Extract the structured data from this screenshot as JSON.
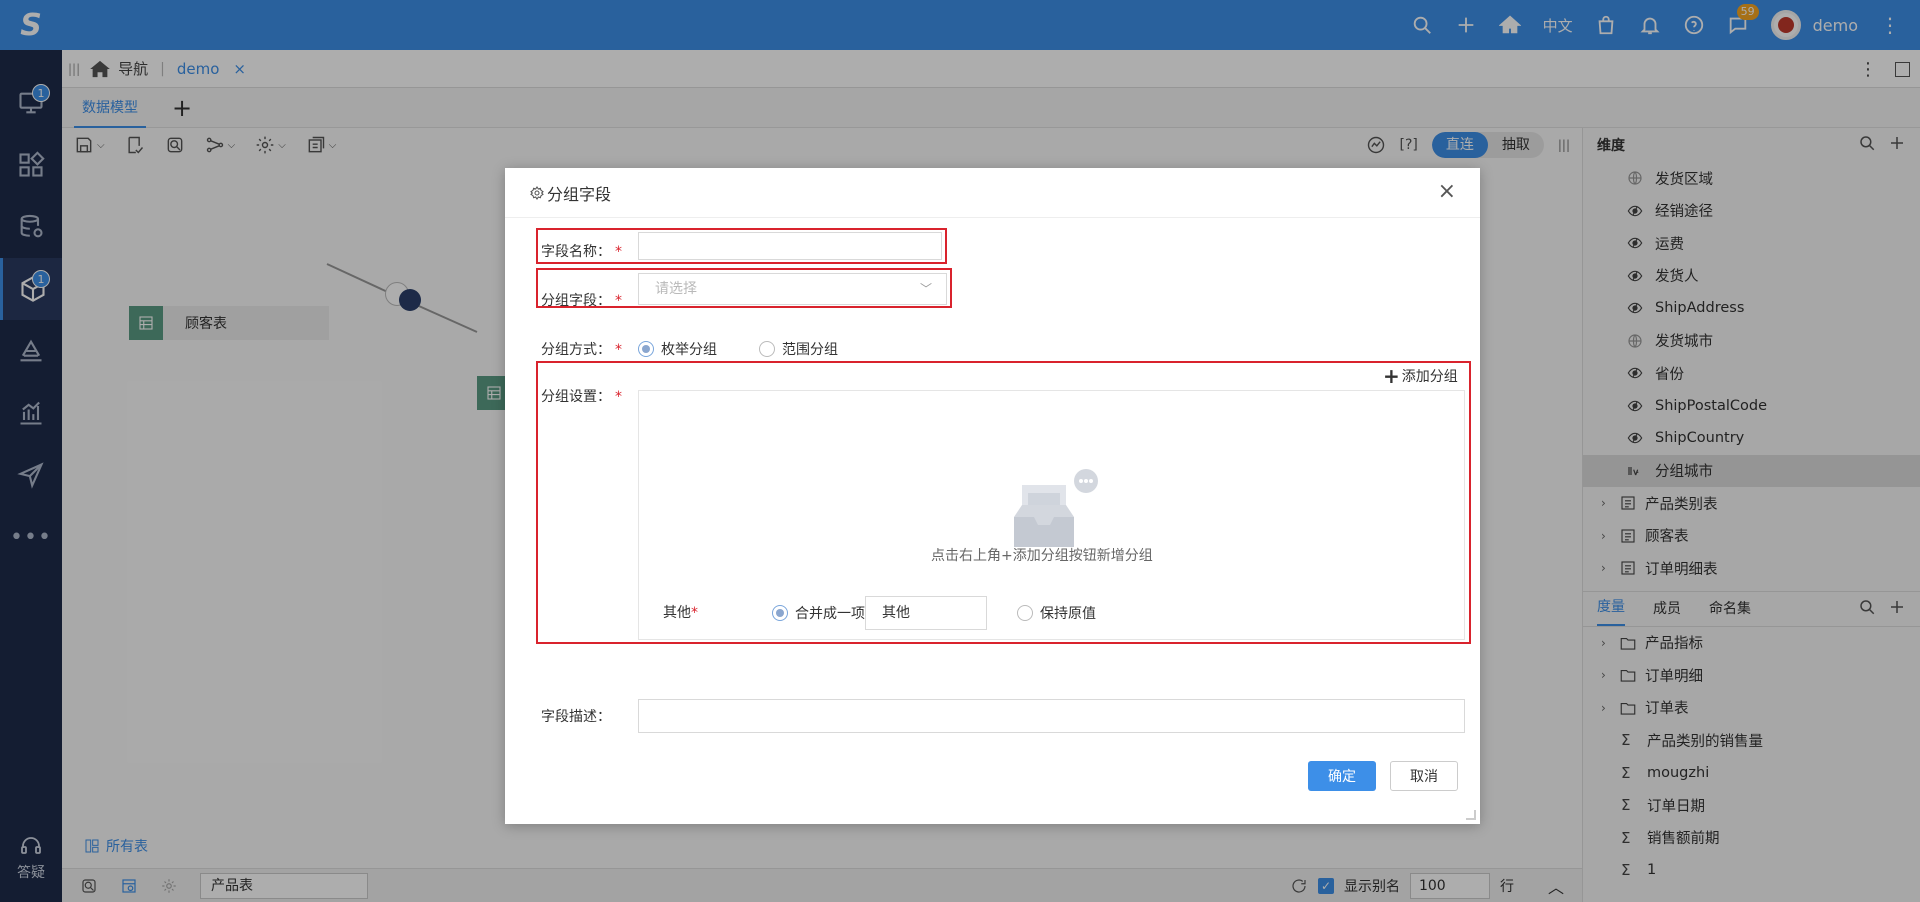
{
  "topbar": {
    "lang": "中文",
    "message_count": "59",
    "user": "demo"
  },
  "rail": {
    "badge_top": "1",
    "badge_model": "1",
    "help_label": "答疑"
  },
  "nav": {
    "home_label": "导航",
    "tab_label": "demo",
    "close": "×"
  },
  "model_tabs": {
    "active": "数据模型",
    "add": "+"
  },
  "canvas_toolbar": {
    "help": "[?]",
    "mode_direct": "直连",
    "mode_extract": "抽取"
  },
  "canvas": {
    "nodes": [
      {
        "label": "顾客表"
      }
    ],
    "all_tables": "所有表"
  },
  "bottom": {
    "table_select": "产品表",
    "show_alias": "显示别名",
    "rows": "100",
    "rows_unit": "行"
  },
  "dimensions": {
    "title": "维度",
    "fields": [
      {
        "label": "发货区域",
        "icon": "globe-icon"
      },
      {
        "label": "经销途径",
        "icon": "eye-icon"
      },
      {
        "label": "运费",
        "icon": "eye-icon"
      },
      {
        "label": "发货人",
        "icon": "eye-icon"
      },
      {
        "label": "ShipAddress",
        "icon": "eye-icon"
      },
      {
        "label": "发货城市",
        "icon": "globe-icon"
      },
      {
        "label": "省份",
        "icon": "eye-icon"
      },
      {
        "label": "ShipPostalCode",
        "icon": "eye-icon"
      },
      {
        "label": "ShipCountry",
        "icon": "eye-icon"
      },
      {
        "label": "分组城市",
        "icon": "group-field-icon",
        "selected": true
      }
    ],
    "tables": [
      {
        "label": "产品类别表"
      },
      {
        "label": "顾客表"
      },
      {
        "label": "订单明细表"
      }
    ]
  },
  "measures": {
    "tabs": [
      "度量",
      "成员",
      "命名集"
    ],
    "folders": [
      "产品指标",
      "订单明细",
      "订单表"
    ],
    "items": [
      "产品类别的销售量",
      "mougzhi",
      "订单日期",
      "销售额前期",
      "1"
    ]
  },
  "dialog": {
    "title": "分组字段",
    "close": "×",
    "field_name_label": "字段名称：",
    "field_name_value": "",
    "group_field_label": "分组字段：",
    "group_field_placeholder": "请选择",
    "group_mode_label": "分组方式：",
    "mode_enum": "枚举分组",
    "mode_range": "范围分组",
    "group_settings_label": "分组设置：",
    "add_group": "添加分组",
    "empty_hint": "点击右上角+添加分组按钮新增分组",
    "other_label": "其他",
    "merge_option": "合并成一项",
    "other_value": "其他",
    "keep_option": "保持原值",
    "desc_label": "字段描述：",
    "desc_value": "",
    "required_mark": "*",
    "ok": "确定",
    "cancel": "取消"
  },
  "colors": {
    "accent": "#3d8fe8",
    "highlight": "#d9232d",
    "rail": "#1e2b4a"
  }
}
